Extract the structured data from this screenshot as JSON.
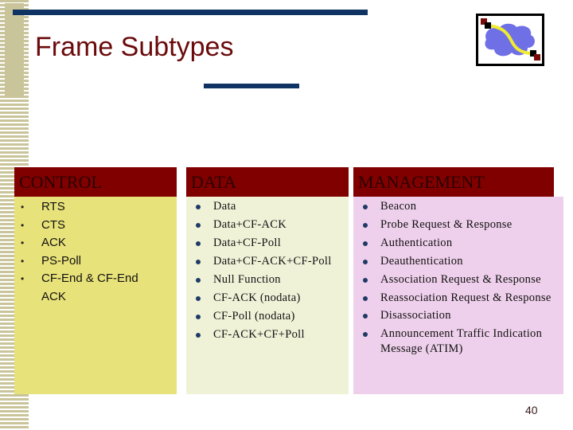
{
  "slide": {
    "title": "Frame Subtypes",
    "page_number": "40",
    "logo_icon": "network-cloud-link-icon"
  },
  "columns": [
    {
      "header": "CONTROL",
      "items": [
        "RTS",
        "CTS",
        "ACK",
        "PS-Poll",
        "CF-End & CF-End ACK"
      ]
    },
    {
      "header": "DATA",
      "items": [
        "Data",
        "Data+CF-ACK",
        "Data+CF-Poll",
        "Data+CF-ACK+CF-Poll",
        "Null Function",
        "CF-ACK (nodata)",
        "CF-Poll (nodata)",
        "CF-ACK+CF+Poll"
      ]
    },
    {
      "header": "MANAGEMENT",
      "items": [
        "Beacon",
        "Probe Request & Response",
        "Authentication",
        "Deauthentication",
        "Association Request & Response",
        "Reassociation Request & Response",
        "Disassociation",
        "Announcement Traffic Indication Message (ATIM)"
      ]
    }
  ],
  "colors": {
    "header_bg": "#800000",
    "control_bg": "#e8e27a",
    "data_bg": "#f0f2d8",
    "management_bg": "#efd0ec",
    "accent_bar": "#0f3464",
    "title_color": "#6b0a0a"
  }
}
